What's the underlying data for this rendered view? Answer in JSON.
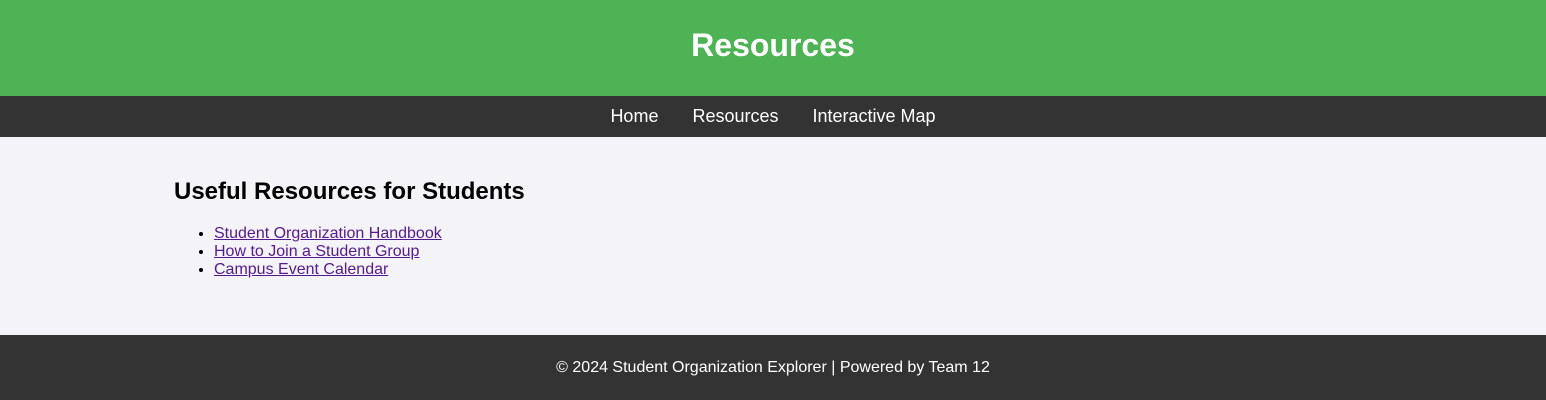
{
  "header": {
    "title": "Resources"
  },
  "nav": {
    "items": [
      {
        "label": "Home"
      },
      {
        "label": "Resources"
      },
      {
        "label": "Interactive Map"
      }
    ]
  },
  "main": {
    "heading": "Useful Resources for Students",
    "links": [
      {
        "label": "Student Organization Handbook"
      },
      {
        "label": "How to Join a Student Group"
      },
      {
        "label": "Campus Event Calendar"
      }
    ]
  },
  "footer": {
    "text": "© 2024 Student Organization Explorer | Powered by Team 12"
  },
  "colors": {
    "header_bg": "#4db354",
    "nav_bg": "#333333",
    "page_bg": "#f4f3f8",
    "visited_link": "#551a8b"
  }
}
